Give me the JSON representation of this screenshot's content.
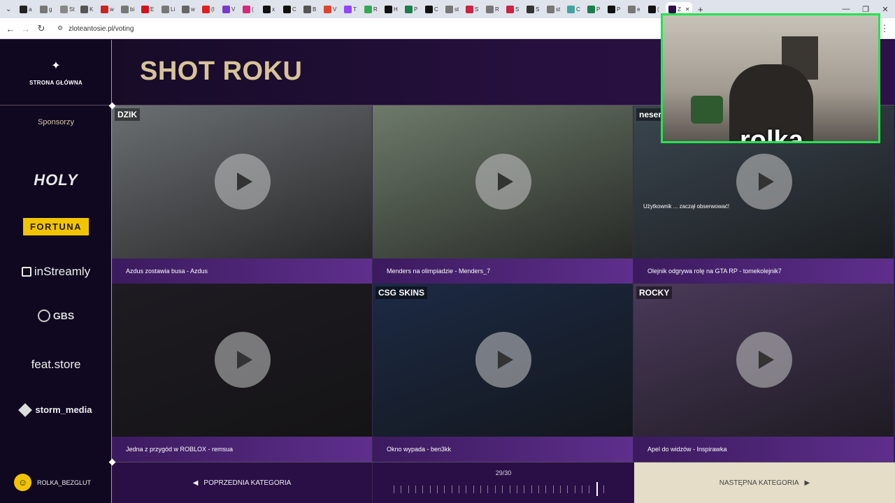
{
  "browser": {
    "tabs": [
      {
        "label": "a",
        "color": "#222222"
      },
      {
        "label": "g",
        "color": "#777777"
      },
      {
        "label": "St",
        "color": "#888888"
      },
      {
        "label": "K",
        "color": "#555555"
      },
      {
        "label": "w",
        "color": "#cc2222"
      },
      {
        "label": "bi",
        "color": "#777777"
      },
      {
        "label": "E",
        "color": "#d2141e"
      },
      {
        "label": "Li",
        "color": "#777777"
      },
      {
        "label": "w",
        "color": "#666666"
      },
      {
        "label": "(I",
        "color": "#e02020"
      },
      {
        "label": "V",
        "color": "#7a3cc6"
      },
      {
        "label": "(",
        "color": "#d6287a"
      },
      {
        "label": "x",
        "color": "#111111"
      },
      {
        "label": "C",
        "color": "#111111"
      },
      {
        "label": "B",
        "color": "#555555"
      },
      {
        "label": "V",
        "color": "#e0432c"
      },
      {
        "label": "T",
        "color": "#9146ff"
      },
      {
        "label": "R",
        "color": "#34a853"
      },
      {
        "label": "H",
        "color": "#111111"
      },
      {
        "label": "P",
        "color": "#1b7c4c"
      },
      {
        "label": "C",
        "color": "#111111"
      },
      {
        "label": "st",
        "color": "#777777"
      },
      {
        "label": "S",
        "color": "#cc2244"
      },
      {
        "label": "R",
        "color": "#777777"
      },
      {
        "label": "S",
        "color": "#cc2244"
      },
      {
        "label": "S",
        "color": "#333333"
      },
      {
        "label": "st",
        "color": "#777777"
      },
      {
        "label": "C",
        "color": "#3fa4a0"
      },
      {
        "label": "P",
        "color": "#1b7c4c"
      },
      {
        "label": "P",
        "color": "#111111"
      },
      {
        "label": "e",
        "color": "#777777"
      },
      {
        "label": "(",
        "color": "#111111"
      },
      {
        "label": "Z",
        "color": "#2d1148",
        "active": true
      }
    ],
    "new_tab": "+",
    "url": "zloteantosie.pl/voting"
  },
  "page": {
    "home_label": "STRONA GŁÓWNA",
    "title": "SHOT ROKU",
    "sponsors_title": "Sponsorzy",
    "sponsors": [
      "HOLY",
      "FORTUNA",
      "inStreamly",
      "GBS",
      "feat.store",
      "storm_media"
    ],
    "user_name": "ROLKA_BEZGLUT",
    "cards": [
      {
        "caption": "Azdus zostawia busa - Azdus",
        "bg": "#6b6f72",
        "corner_label": "DZIK"
      },
      {
        "caption": "Menders na olimpiadzie - Menders_7",
        "bg": "#6d7a6a",
        "corner_label": ""
      },
      {
        "caption": "Olejnik odgrywa rolę na GTA RP - tomekolejnik7",
        "bg": "#3b4650",
        "corner_label": "neser R"
      },
      {
        "caption": "Jedna z przygód w ROBLOX - remsua",
        "bg": "#1e1b22",
        "corner_label": ""
      },
      {
        "caption": "Okno wypada - ben3kk",
        "bg": "#1c2a44",
        "corner_label": "CSG SKINS"
      },
      {
        "caption": "Apel do widzów - Inspirawka",
        "bg": "#4a3a5a",
        "corner_label": "ROCKY"
      }
    ],
    "overlay_texts": {
      "gta_follow": "Użytkownik ... zaczął obserwować!"
    },
    "prev_label": "POPRZEDNIA KATEGORIA",
    "next_label": "NASTĘPNA KATEGORIA",
    "counter": "29/30",
    "progress": {
      "current": 29,
      "total": 30
    }
  },
  "webcam": {
    "label": "rolka",
    "border_color": "#21e54c"
  },
  "colors": {
    "accent_gold": "#d8c39a",
    "fortuna_yellow": "#f2c400",
    "next_bg": "#e5ddc8"
  }
}
